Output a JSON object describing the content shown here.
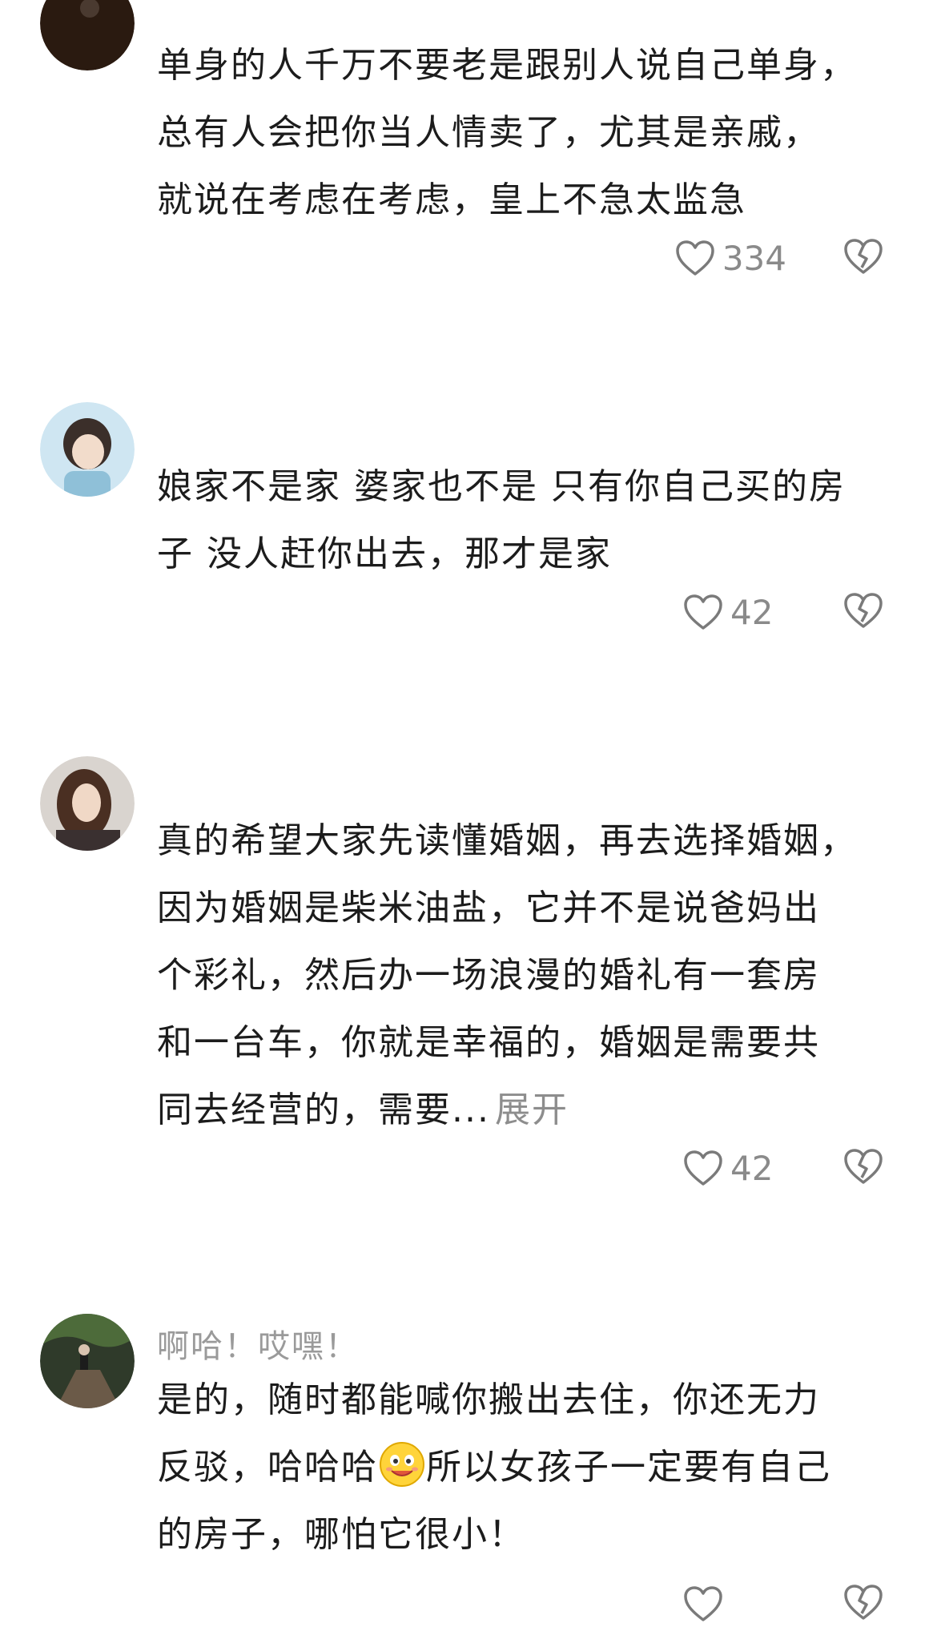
{
  "comments": [
    {
      "username": "",
      "text_lines": [
        "单身的人千万不要老是跟别人说自己单身，",
        "总有人会把你当人情卖了，尤其是亲戚，",
        "就说在考虑在考虑，皇上不急太监急"
      ],
      "likes": "334"
    },
    {
      "username": "",
      "text_lines": [
        "娘家不是家 婆家也不是 只有你自己买的房",
        "子 没人赶你出去，那才是家"
      ],
      "likes": "42"
    },
    {
      "username": "",
      "text_lines": [
        "真的希望大家先读懂婚姻，再去选择婚姻，",
        "因为婚姻是柴米油盐，它并不是说爸妈出",
        "个彩礼，然后办一场浪漫的婚礼有一套房",
        "和一台车，你就是幸福的，婚姻是需要共",
        "同去经营的，需要..."
      ],
      "expand_label": "展开",
      "likes": "42"
    },
    {
      "username": "啊哈！哎嘿！",
      "text_lines": [
        "是的，随时都能喊你搬出去住，你还无力",
        "反驳，哈哈哈",
        "所以女孩子一定要有自己",
        "的房子，哪怕它很小！"
      ],
      "likes": ""
    }
  ],
  "icons": {
    "like": "heart-outline-icon",
    "dislike": "broken-heart-icon",
    "emoji": "smiley-emoji-icon"
  },
  "colors": {
    "text": "#1c1c1c",
    "muted": "#8a8a8a",
    "icon": "#7a7a7a"
  }
}
